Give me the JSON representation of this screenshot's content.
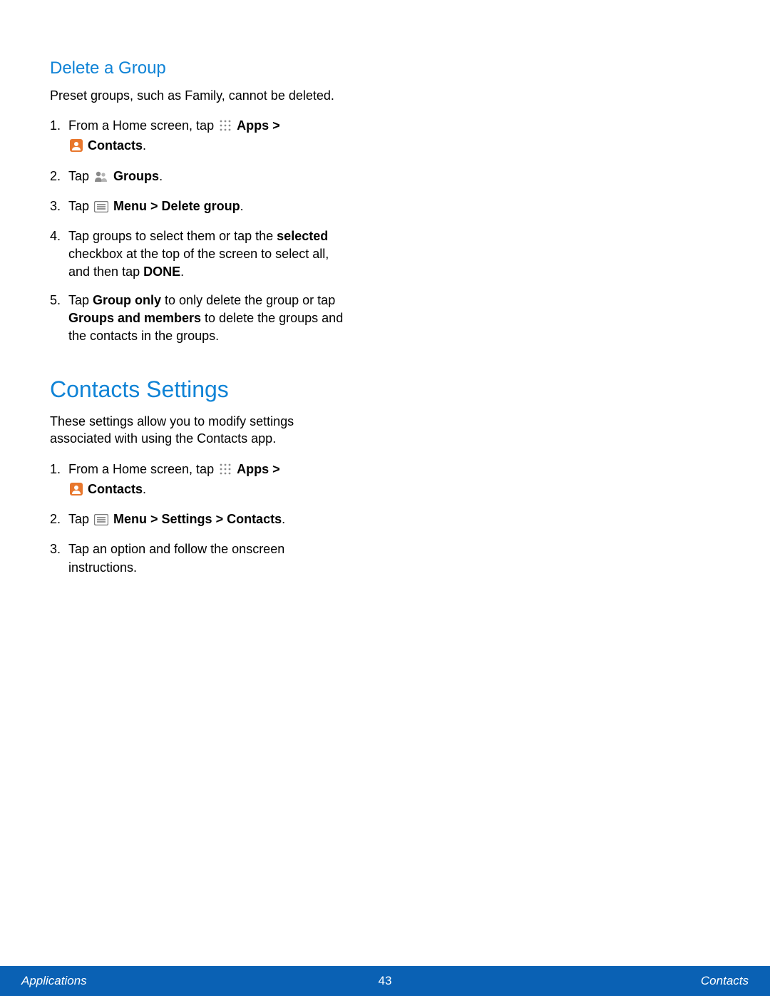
{
  "section1": {
    "heading": "Delete a Group",
    "intro": "Preset groups, such as Family, cannot be deleted.",
    "steps": {
      "s1_pre": "From a Home screen, tap ",
      "s1_apps": "Apps > ",
      "s1_contacts": "Contacts",
      "s2_pre": "Tap ",
      "s2_groups": "Groups",
      "s3_pre": "Tap ",
      "s3_menu": "Menu > Delete group",
      "s4_a": "Tap groups to select them or tap the ",
      "s4_b": "selected",
      "s4_c": " checkbox at the top of the screen to select all, and then tap ",
      "s4_d": "DONE",
      "s5_a": "Tap ",
      "s5_b": "Group only",
      "s5_c": " to only delete the group or tap ",
      "s5_d": "Groups and members",
      "s5_e": " to delete the groups and the contacts in the groups."
    }
  },
  "section2": {
    "heading": "Contacts Settings",
    "intro": "These settings allow you to modify settings associated with using the Contacts app.",
    "steps": {
      "s1_pre": "From a Home screen, tap ",
      "s1_apps": "Apps > ",
      "s1_contacts": "Contacts",
      "s2_pre": "Tap ",
      "s2_menu": "Menu > Settings > Contacts",
      "s3": "Tap an option and follow the onscreen instructions."
    }
  },
  "footer": {
    "left": "Applications",
    "center": "43",
    "right": "Contacts"
  }
}
